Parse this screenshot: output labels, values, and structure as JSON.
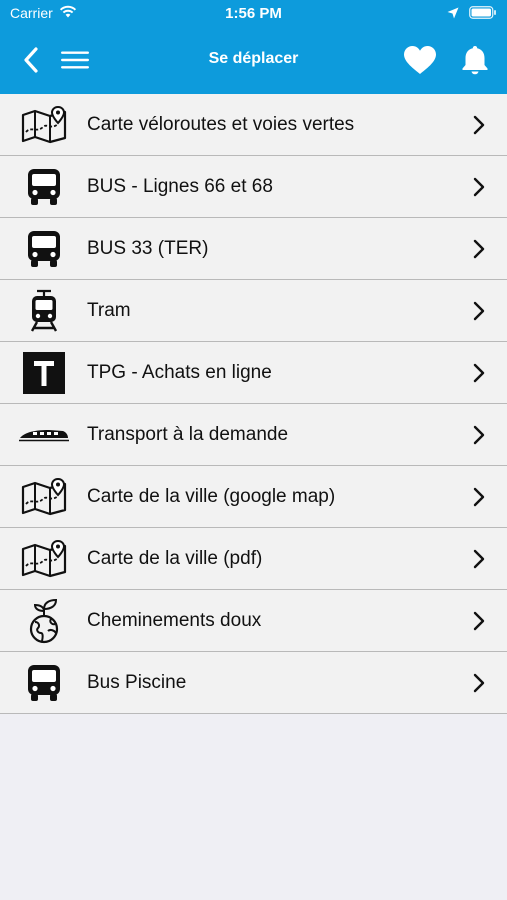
{
  "status_bar": {
    "carrier": "Carrier",
    "time": "1:56 PM"
  },
  "nav": {
    "title": "Se déplacer"
  },
  "colors": {
    "header_bg": "#0d9bdc",
    "row_bg": "#f2f2f2",
    "page_bg": "#efeff4"
  },
  "items": [
    {
      "label": "Carte véloroutes et voies vertes",
      "icon": "map-icon"
    },
    {
      "label": "BUS - Lignes 66 et 68",
      "icon": "bus-icon"
    },
    {
      "label": "BUS 33 (TER)",
      "icon": "bus-icon"
    },
    {
      "label": "Tram",
      "icon": "tram-icon"
    },
    {
      "label": "TPG - Achats en ligne",
      "icon": "tpg-icon"
    },
    {
      "label": "Transport à la demande",
      "icon": "train-icon"
    },
    {
      "label": "Carte de la ville (google map)",
      "icon": "map-icon"
    },
    {
      "label": "Carte de la ville (pdf)",
      "icon": "map-icon"
    },
    {
      "label": "Cheminements doux",
      "icon": "eco-globe-icon"
    },
    {
      "label": "Bus Piscine",
      "icon": "bus-icon"
    }
  ]
}
